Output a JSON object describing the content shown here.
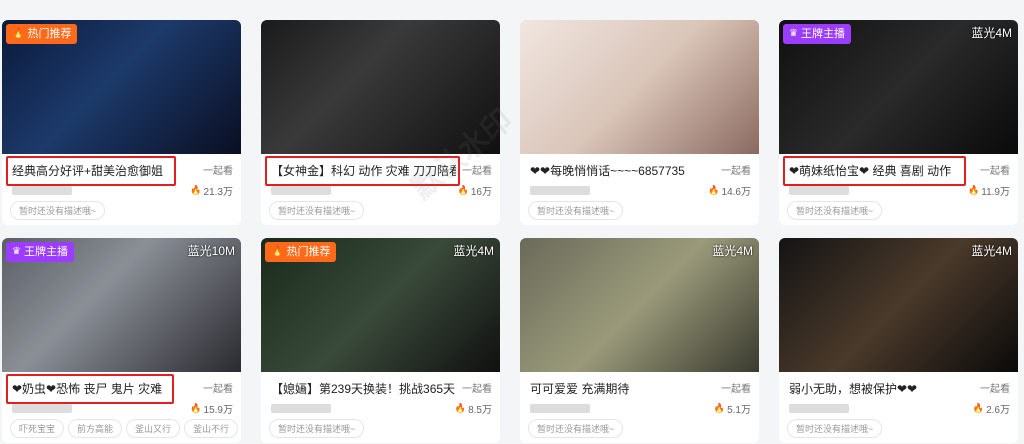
{
  "cards": [
    {
      "badge": "热门推荐",
      "badge_type": "hot",
      "quality": "",
      "title": "经典高分好评+甜美治愈御姐",
      "watch": "一起看",
      "heat": "21.3万",
      "tags": [
        "暂时还没有描述哦~"
      ]
    },
    {
      "badge": "",
      "badge_type": "",
      "quality": "",
      "title": "【女神金】科幻 动作 灾难 刀刀陪看",
      "watch": "一起看",
      "heat": "16万",
      "tags": [
        "暂时还没有描述哦~"
      ]
    },
    {
      "badge": "",
      "badge_type": "",
      "quality": "",
      "title": "❤❤每晚悄悄话~~~~6857735",
      "watch": "一起看",
      "heat": "14.6万",
      "tags": [
        "暂时还没有描述哦~"
      ]
    },
    {
      "badge": "王牌主播",
      "badge_type": "king",
      "quality": "蓝光4M",
      "title": "❤萌妹纸怡宝❤ 经典 喜剧 动作",
      "watch": "一起看",
      "heat": "11.9万",
      "tags": [
        "暂时还没有描述哦~"
      ]
    },
    {
      "badge": "王牌主播",
      "badge_type": "king",
      "quality": "蓝光10M",
      "title": "❤奶虫❤恐怖 丧尸 鬼片 灾难",
      "watch": "一起看",
      "heat": "15.9万",
      "tags": [
        "吓死宝宝",
        "前方高能",
        "釜山又行",
        "釜山不行"
      ]
    },
    {
      "badge": "热门推荐",
      "badge_type": "hot",
      "quality": "蓝光4M",
      "title": "【媳婳】第239天换装！挑战365天",
      "watch": "一起看",
      "heat": "8.5万",
      "tags": [
        "暂时还没有描述哦~"
      ]
    },
    {
      "badge": "",
      "badge_type": "",
      "quality": "蓝光4M",
      "title": "可可爱爱 充满期待",
      "watch": "一起看",
      "heat": "5.1万",
      "tags": [
        "暂时还没有描述哦~"
      ]
    },
    {
      "badge": "",
      "badge_type": "",
      "quality": "蓝光4M",
      "title": "弱小无助，想被保护❤❤",
      "watch": "一起看",
      "heat": "2.6万",
      "tags": [
        "暂时还没有描述哦~"
      ]
    }
  ],
  "colors": {
    "hot": "#ff6a1a",
    "king": "#9b3cff",
    "highlight": "#e02020"
  },
  "icons": {
    "fire": "fire-icon",
    "crown": "crown-icon"
  }
}
